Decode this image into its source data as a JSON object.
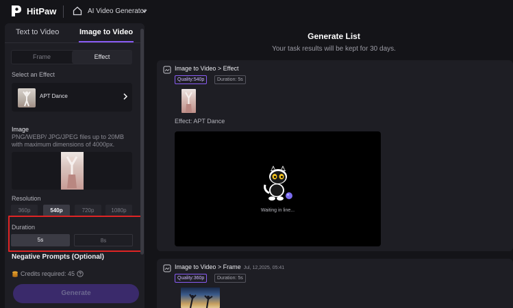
{
  "header": {
    "brand": "HitPaw",
    "product": "AI Video Generator"
  },
  "left_panel": {
    "tabs": [
      {
        "label": "Text to Video",
        "active": false
      },
      {
        "label": "Image to Video",
        "active": true
      }
    ],
    "mode_segment": {
      "frame_label": "Frame",
      "effect_label": "Effect",
      "selected": "Effect"
    },
    "select_effect_label": "Select an Effect",
    "effect": {
      "name": "APT Dance"
    },
    "image_label": "Image",
    "image_desc": "PNG/WEBP/ JPG/JPEG files up to 20MB with maximum dimensions of 4000px.",
    "resolution_label": "Resolution",
    "resolutions": [
      {
        "label": "360p",
        "selected": false
      },
      {
        "label": "540p",
        "selected": true
      },
      {
        "label": "720p",
        "selected": false
      },
      {
        "label": "1080p",
        "selected": false
      }
    ],
    "duration_label": "Duration",
    "durations": [
      {
        "label": "5s",
        "selected": true
      },
      {
        "label": "8s",
        "selected": false
      }
    ],
    "negative_prompts_label": "Negative Prompts (Optional)",
    "credits_text": "Credits required: 45",
    "generate_label": "Generate"
  },
  "main": {
    "title": "Generate List",
    "subtitle": "Your task results will be kept for 30 days.",
    "tasks": [
      {
        "title": "Image to Video > Effect",
        "time": "",
        "quality": "Quality:540p",
        "duration": "Duration: 5s",
        "effect_text": "Effect: APT Dance",
        "status": "Waiting in line..."
      },
      {
        "title": "Image to Video > Frame",
        "time": "Jul, 12,2025, 05:41",
        "quality": "Quality:360p",
        "duration": "Duration: 5s"
      }
    ]
  },
  "colors": {
    "background": "#141418",
    "panel": "#1e1e24",
    "accent": "#8a5cf6",
    "highlight_box": "#e02424",
    "generate_button": "#3a2a6b"
  }
}
